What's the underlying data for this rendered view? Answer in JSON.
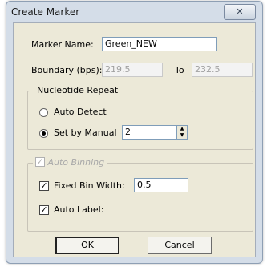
{
  "dialog": {
    "title": "Create Marker",
    "close_glyph": "✕",
    "marker_name_label": "Marker Name:",
    "marker_name_value": "Green_NEW",
    "boundary_label": "Boundary (bps):",
    "boundary_from": "219.5",
    "to_label": "To",
    "boundary_to": "232.5",
    "nucleotide_group": "Nucleotide Repeat",
    "auto_detect_label": "Auto Detect",
    "auto_detect_checked": false,
    "set_manual_label": "Set by Manual",
    "set_manual_checked": true,
    "manual_value": "2",
    "auto_binning_label": "Auto Binning",
    "auto_binning_checked": true,
    "auto_binning_enabled": false,
    "fixed_bin_label": "Fixed Bin Width:",
    "fixed_bin_checked": true,
    "fixed_bin_value": "0.5",
    "auto_label_label": "Auto Label:",
    "auto_label_checked": true,
    "ok_label": "OK",
    "cancel_label": "Cancel"
  },
  "icons": [
    "close-icon",
    "spin-up-icon",
    "spin-down-icon",
    "checkmark-icon"
  ],
  "colors": {
    "window_frame": "#d4dde8",
    "client_bg": "#ece9d8",
    "disabled_text": "#a0a0a0"
  }
}
